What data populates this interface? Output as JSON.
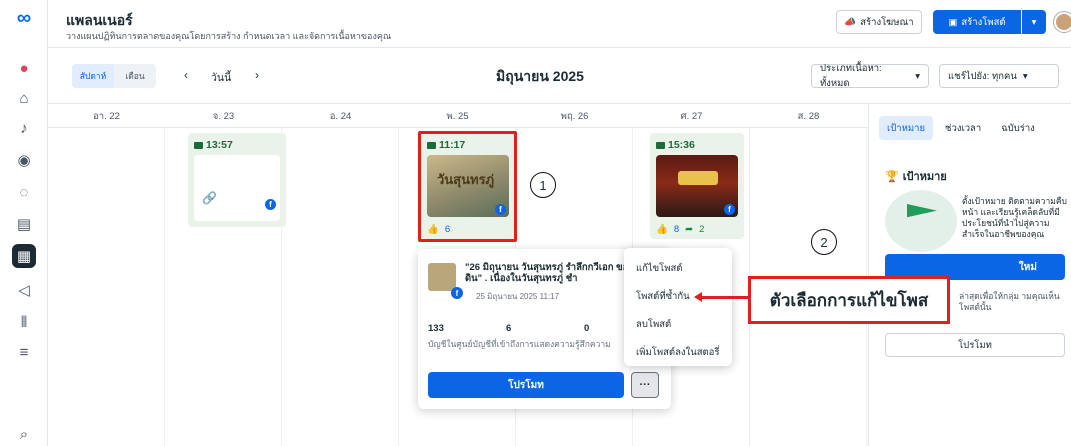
{
  "header": {
    "title": "แพลนเนอร์",
    "subtitle": "วางแผนปฏิทินการตลาดของคุณโดยการสร้าง กำหนดเวลา และจัดการเนื้อหาของคุณ",
    "create_ad_label": "สร้างโฆษณา",
    "create_post_label": "สร้างโพสต์"
  },
  "toolbar": {
    "view_week": "สัปดาห์",
    "view_month": "เดือน",
    "day_label": "วันนี้",
    "month_title": "มิถุนายน 2025",
    "content_type_filter": "ประเภทเนื้อหา: ทั้งหมด",
    "shared_to_filter": "แชร์ไปยัง: ทุกคน"
  },
  "days": [
    "อา. 22",
    "จ. 23",
    "อ. 24",
    "พ. 25",
    "พฤ. 26",
    "ศ. 27",
    "ส. 28"
  ],
  "posts": {
    "mon": {
      "time": "13:57"
    },
    "wed": {
      "time": "11:17",
      "likes": "6"
    },
    "fri": {
      "time": "15:36",
      "likes": "8",
      "shares": "2"
    }
  },
  "popup": {
    "title": "\"26 มิถุนายน วันสุนทรภู่ รำลึกกวีเอก ของแผ่นดิน\" . เนื่องในวันสุนทรภู่ ชำ",
    "date": "25 มิถุนายน 2025 11:17",
    "stat1": "133",
    "stat2": "6",
    "stat3": "0",
    "note": "บัญชีในศูนย์บัญชีที่เข้าถึงการแสดงความรู้สึกความ",
    "promote_label": "โปรโมท",
    "more_label": "···"
  },
  "menu": {
    "items": [
      "แก้ไขโพสต์",
      "โพสต์ที่ซ้ำกัน",
      "ลบโพสต์",
      "เพิ่มโพสต์ลงในสตอรี่"
    ]
  },
  "annotations": {
    "circle1": "1",
    "circle2": "2",
    "callout": "ตัวเลือกการแก้ไขโพส"
  },
  "right_panel": {
    "tabs": [
      "เป้าหมาย",
      "ช่วงเวลา",
      "ฉบับร่าง"
    ],
    "goal_title": "เป้าหมาย",
    "goal_desc": "ตั้งเป้าหมาย ติดตามความคืบหน้า และเรียนรู้เคล็ดลับที่มีประโยชน์ที่นำไปสู่ความสำเร็จในอาชีพของคุณ",
    "goal_button": "ใหม่",
    "tips_text": "ล่าสุดเพื่อให้กลุ่ม ามคุณเห็นโพสต์นั้น",
    "promote_label": "โปรโมท"
  },
  "colors": {
    "accent": "#0a66e4",
    "annotation_red": "#e02020",
    "card_green_bg": "#e9f3ea"
  }
}
